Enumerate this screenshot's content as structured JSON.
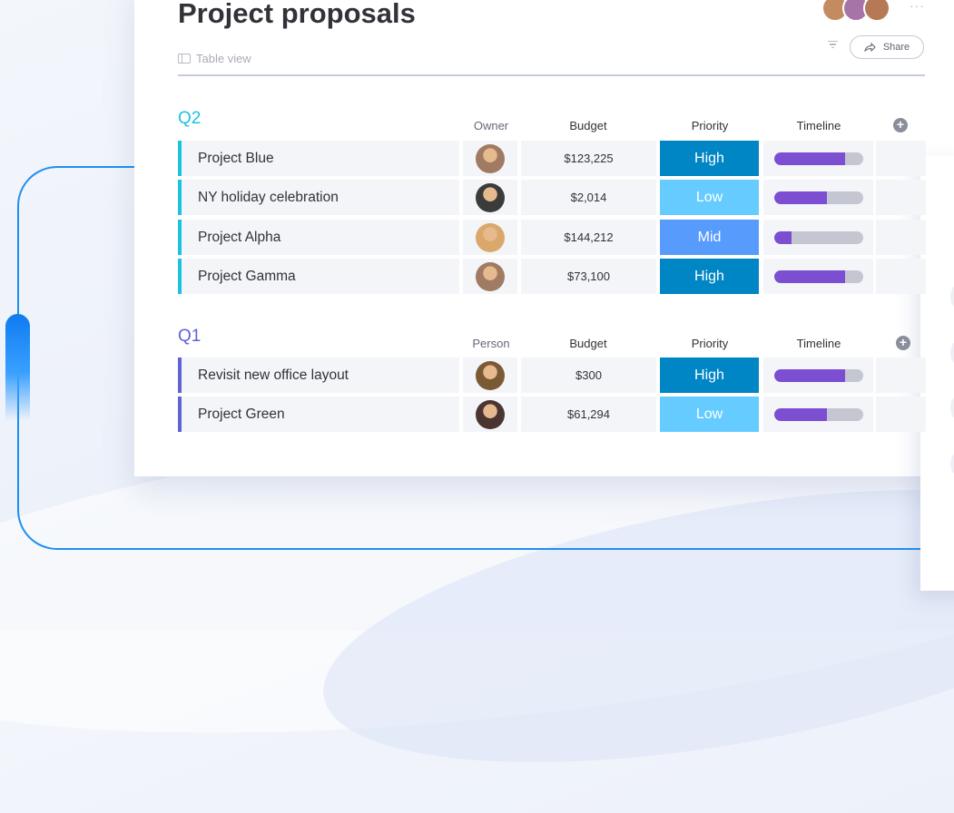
{
  "page": {
    "title": "Project proposals",
    "view_tab": "Table view",
    "share_label": "Share",
    "more_label": "···"
  },
  "colors": {
    "q2_group": "#1cc3e0",
    "q1_group": "#6161d8",
    "priority_high": "#0085c5",
    "priority_low": "#66ccff",
    "priority_mid": "#579bfc",
    "timeline_fill": "#7b4ed2",
    "timeline_track": "#c4c6d1",
    "connector": "#1e8ff2"
  },
  "header_avatars": [
    {
      "name": "avatar",
      "bg": "#c48a60"
    },
    {
      "name": "avatar",
      "bg": "#a874a8"
    },
    {
      "name": "avatar",
      "bg": "#b57a55"
    }
  ],
  "groups": [
    {
      "name": "Q2",
      "columns": {
        "owner": "Owner",
        "budget": "Budget",
        "priority": "Priority",
        "timeline": "Timeline"
      },
      "rows": [
        {
          "name": "Project Blue",
          "budget": "$123,225",
          "priority": "High",
          "timeline_progress": 0.8,
          "owner_bg": "#a07a63"
        },
        {
          "name": "NY holiday celebration",
          "budget": "$2,014",
          "priority": "Low",
          "timeline_progress": 0.6,
          "owner_bg": "#3b3b3b"
        },
        {
          "name": "Project Alpha",
          "budget": "$144,212",
          "priority": "Mid",
          "timeline_progress": 0.2,
          "owner_bg": "#d9a86a"
        },
        {
          "name": "Project Gamma",
          "budget": "$73,100",
          "priority": "High",
          "timeline_progress": 0.8,
          "owner_bg": "#a07a63"
        }
      ]
    },
    {
      "name": "Q1",
      "columns": {
        "owner": "Person",
        "budget": "Budget",
        "priority": "Priority",
        "timeline": "Timeline"
      },
      "rows": [
        {
          "name": "Revisit new office layout",
          "budget": "$300",
          "priority": "High",
          "timeline_progress": 0.8,
          "owner_bg": "#7a5a35"
        },
        {
          "name": "Project Green",
          "budget": "$61,294",
          "priority": "Low",
          "timeline_progress": 0.6,
          "owner_bg": "#4a3530"
        }
      ]
    }
  ]
}
